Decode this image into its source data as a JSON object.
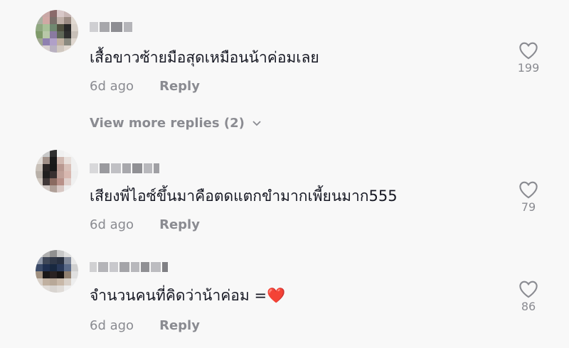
{
  "comments": [
    {
      "text": "เสื้อขาวซ้ายมือสุดเหมือนน้าค่อมเลย",
      "time": "6d ago",
      "reply_label": "Reply",
      "likes": "199"
    },
    {
      "text": "เสียงพี่ไอซ์ขึ้นมาคือตดแตกขำมากเพี้ยนมาก555",
      "time": "6d ago",
      "reply_label": "Reply",
      "likes": "79"
    },
    {
      "text": "จำนวนคนที่คิดว่าน้าค่อม =",
      "emoji": "❤️",
      "time": "6d ago",
      "reply_label": "Reply",
      "likes": "86"
    }
  ],
  "view_more_replies": "View more replies (2)",
  "colors": {
    "background": "#f8f8f8",
    "text": "#161823",
    "muted": "#8a8b91"
  }
}
